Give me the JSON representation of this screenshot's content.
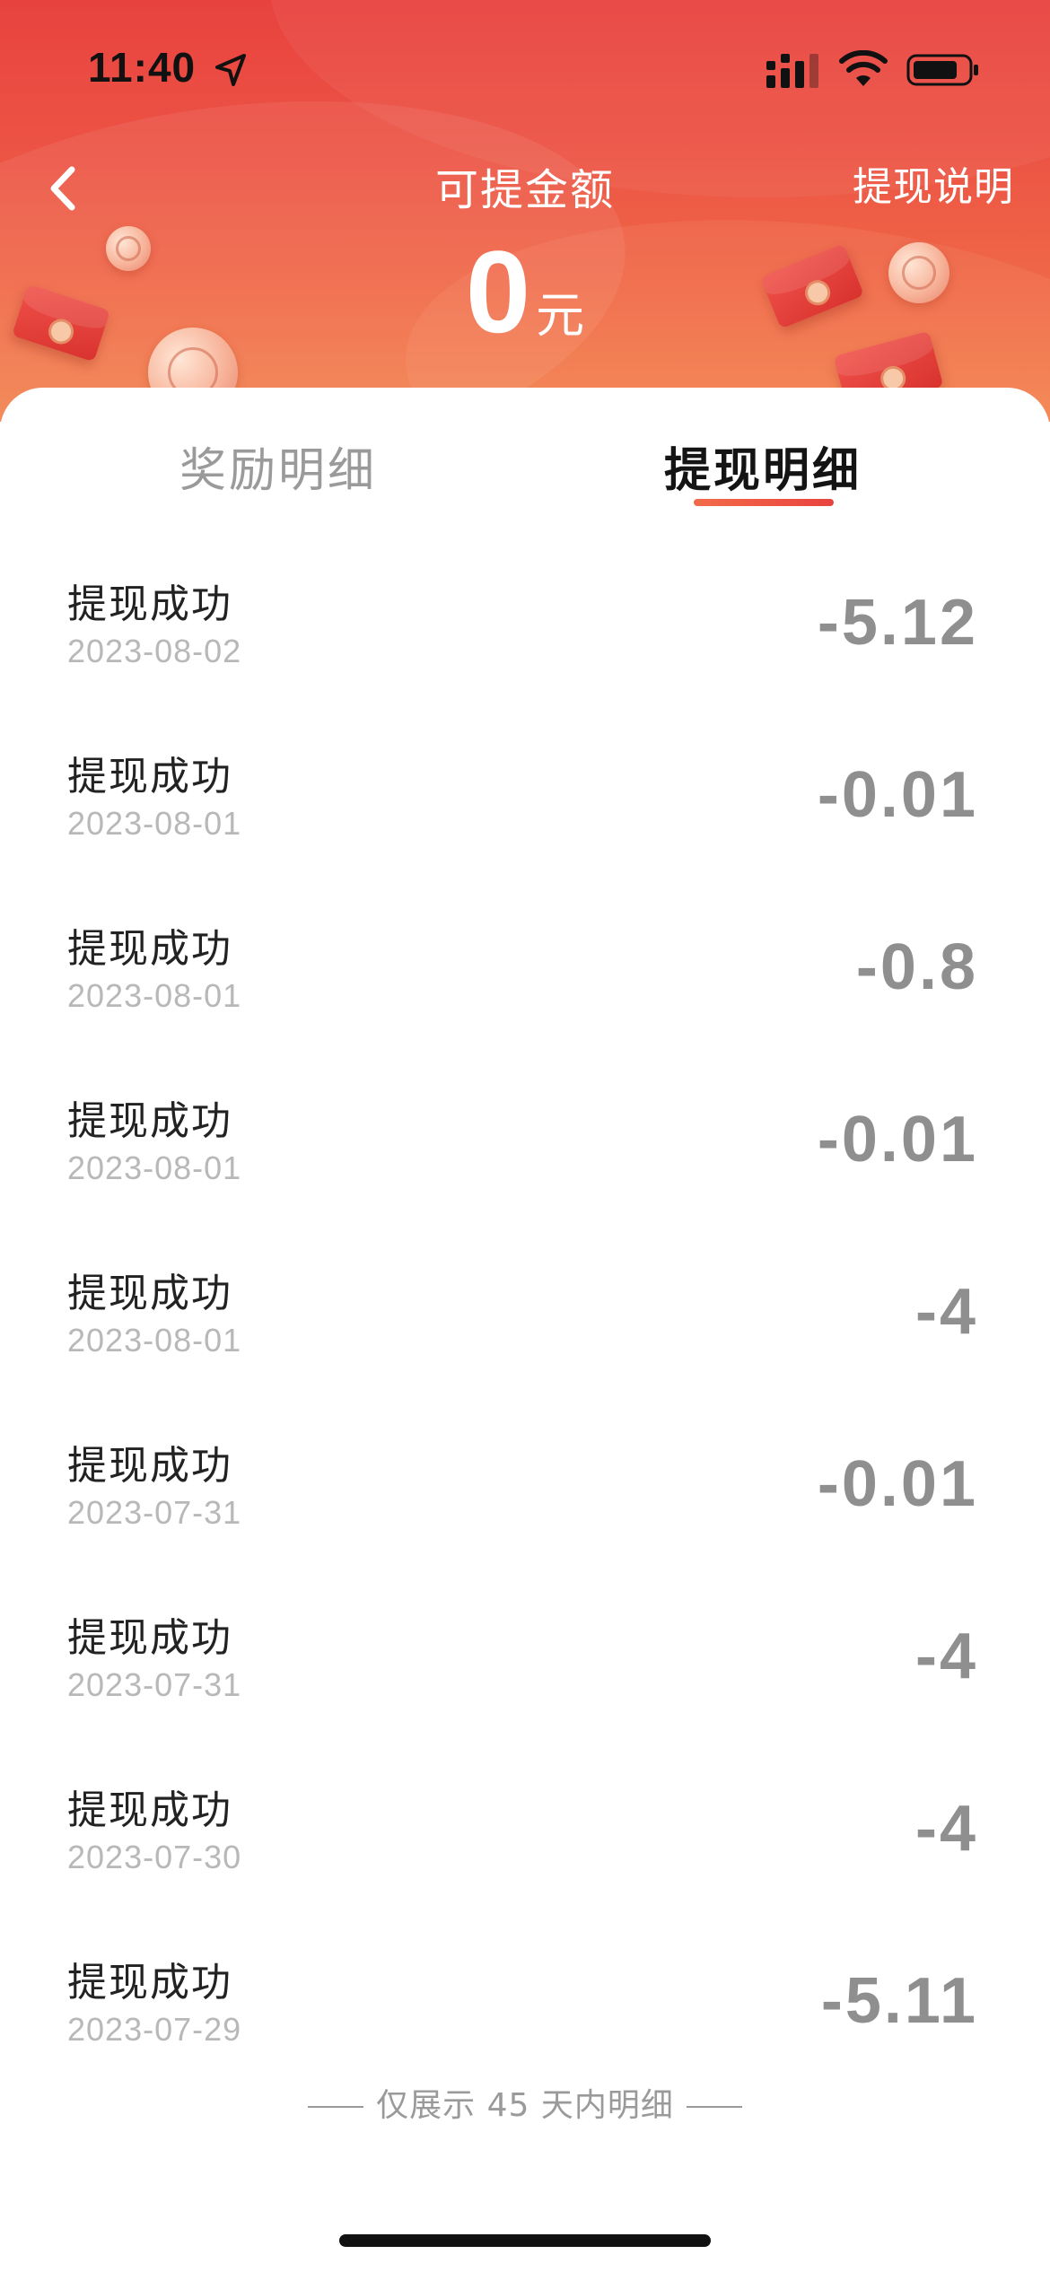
{
  "status_bar": {
    "time": "11:40"
  },
  "header": {
    "title": "可提金额",
    "help_link": "提现说明",
    "balance_amount": "0",
    "balance_unit": "元"
  },
  "tabs": [
    {
      "label": "奖励明细",
      "active": false
    },
    {
      "label": "提现明细",
      "active": true
    }
  ],
  "records": [
    {
      "title": "提现成功",
      "date": "2023-08-02",
      "amount": "-5.12"
    },
    {
      "title": "提现成功",
      "date": "2023-08-01",
      "amount": "-0.01"
    },
    {
      "title": "提现成功",
      "date": "2023-08-01",
      "amount": "-0.8"
    },
    {
      "title": "提现成功",
      "date": "2023-08-01",
      "amount": "-0.01"
    },
    {
      "title": "提现成功",
      "date": "2023-08-01",
      "amount": "-4"
    },
    {
      "title": "提现成功",
      "date": "2023-07-31",
      "amount": "-0.01"
    },
    {
      "title": "提现成功",
      "date": "2023-07-31",
      "amount": "-4"
    },
    {
      "title": "提现成功",
      "date": "2023-07-30",
      "amount": "-4"
    },
    {
      "title": "提现成功",
      "date": "2023-07-29",
      "amount": "-5.11"
    }
  ],
  "footer_note": "仅展示 45 天内明细",
  "colors": {
    "header_red": "#e8423f",
    "header_orange": "#f3844f",
    "accent": "#f36b4a",
    "amount_gray": "#8f8f8f",
    "date_gray": "#b8b8b8"
  },
  "icons": [
    "location-arrow-icon",
    "signal-icon",
    "wifi-icon",
    "battery-icon",
    "back-arrow-icon"
  ]
}
